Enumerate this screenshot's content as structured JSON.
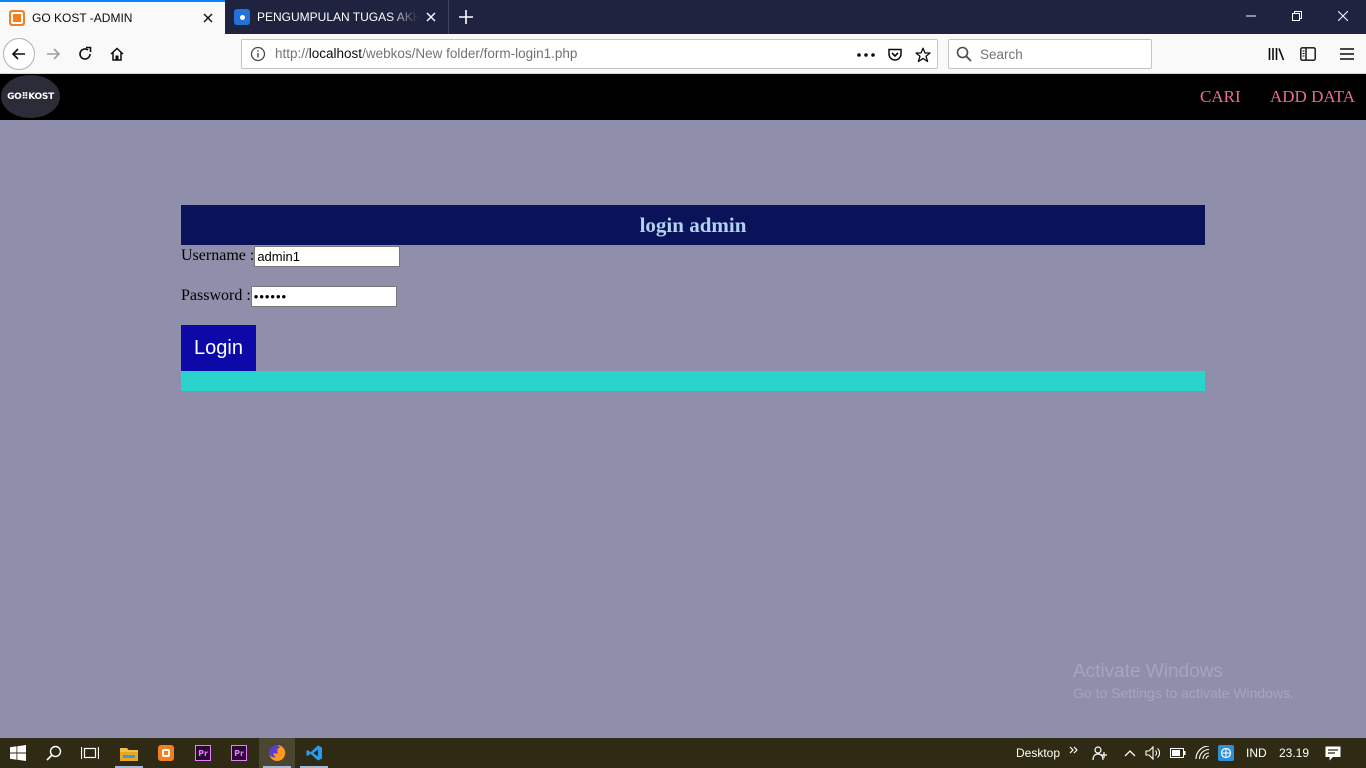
{
  "browser": {
    "tabs": [
      {
        "title": "GO KOST -ADMIN",
        "icon": "xampp-icon",
        "active": true
      },
      {
        "title": "PENGUMPULAN TUGAS AKHIR",
        "icon": "classroom-icon",
        "active": false
      }
    ],
    "url": {
      "prefix": "http://",
      "host": "localhost",
      "path": "/webkos/New folder/form-login1.php"
    },
    "search_placeholder": "Search"
  },
  "site": {
    "logo_text": "GO⠿KOST",
    "nav": [
      {
        "label": "CARI"
      },
      {
        "label": "ADD DATA"
      }
    ],
    "colors": {
      "header_bg": "#000000",
      "nav_link": "#e86d96",
      "page_bg": "#908fab"
    }
  },
  "login": {
    "title": "login admin",
    "username_label": "Username :",
    "username_value": "admin1",
    "password_label": "Password :",
    "password_value": "••••••",
    "button_label": "Login",
    "colors": {
      "title_bar": "#0a1259",
      "button": "#0d08a8",
      "footer_bar": "#2ad3cc"
    }
  },
  "watermark": {
    "line1": "Activate Windows",
    "line2": "Go to Settings to activate Windows."
  },
  "taskbar": {
    "apps": [
      {
        "name": "file-explorer"
      },
      {
        "name": "xampp"
      },
      {
        "name": "premiere-pro",
        "badge": "Pr"
      },
      {
        "name": "premiere-pro",
        "badge": "Pr"
      },
      {
        "name": "firefox"
      },
      {
        "name": "vs-code"
      }
    ],
    "tray": {
      "desktop_label": "Desktop",
      "language": "IND",
      "time": "23.19"
    }
  }
}
